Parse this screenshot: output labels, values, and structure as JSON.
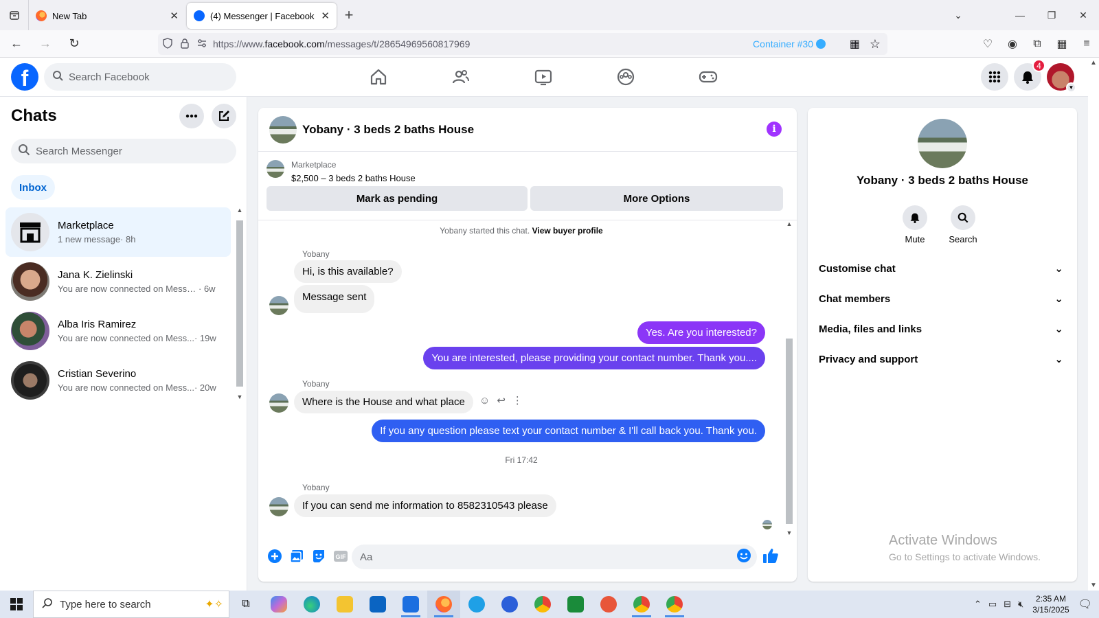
{
  "browser": {
    "tabs": [
      {
        "title": "New Tab",
        "active": false
      },
      {
        "title": "(4) Messenger | Facebook",
        "active": true
      }
    ],
    "url_prefix": "https://www.",
    "url_domain": "facebook.com",
    "url_path": "/messages/t/28654969560817969",
    "container": "Container #30"
  },
  "fb": {
    "search_placeholder": "Search Facebook",
    "notification_count": "4",
    "logo": "f"
  },
  "sidebar": {
    "title": "Chats",
    "search_placeholder": "Search Messenger",
    "filter": "Inbox",
    "chats": [
      {
        "name": "Marketplace",
        "snippet": "1 new message",
        "time": " · 8h",
        "active": true
      },
      {
        "name": "Jana K. Zielinski",
        "snippet": "You are now connected on Messe...",
        "time": " · 6w",
        "active": false
      },
      {
        "name": "Alba Iris Ramirez",
        "snippet": "You are now connected on Mess...",
        "time": " · 19w",
        "active": false
      },
      {
        "name": "Cristian Severino",
        "snippet": "You are now connected on Mess...",
        "time": " · 20w",
        "active": false
      }
    ]
  },
  "conversation": {
    "title": "Yobany · 3 beds 2 baths House",
    "marketplace_label": "Marketplace",
    "listing": "$2,500 – 3 beds 2 baths House",
    "mark_pending": "Mark as pending",
    "more_options": "More Options",
    "started_text": "Yobany started this chat.",
    "view_profile": "View buyer profile",
    "sender": "Yobany",
    "messages": [
      {
        "from": "them",
        "text": "Hi, is this available?"
      },
      {
        "from": "them",
        "text": "Message sent"
      },
      {
        "from": "me",
        "text": "Yes. Are you interested?"
      },
      {
        "from": "me",
        "text": "You are interested, please providing your contact number. Thank you...."
      },
      {
        "from": "them",
        "text": "Where is the House and  what place"
      },
      {
        "from": "me",
        "text": "If you any question please text your contact number & I'll call back you. Thank you."
      },
      {
        "from": "them",
        "text": "If you can send me information  to 8582310543 please"
      }
    ],
    "timestamp": "Fri 17:42",
    "composer_placeholder": "Aa",
    "colors": {
      "accent": "#7b3ff2",
      "bubble_top": "#a033ff",
      "bubble_bottom": "#0a7cff"
    }
  },
  "info_panel": {
    "name": "Yobany · 3 beds 2 baths House",
    "mute": "Mute",
    "search": "Search",
    "sections": [
      "Customise chat",
      "Chat members",
      "Media, files and links",
      "Privacy and support"
    ]
  },
  "watermark": {
    "line1": "Activate Windows",
    "line2": "Go to Settings to activate Windows."
  },
  "taskbar": {
    "search_placeholder": "Type here to search",
    "time": "2:35 AM",
    "date": "3/15/2025"
  }
}
